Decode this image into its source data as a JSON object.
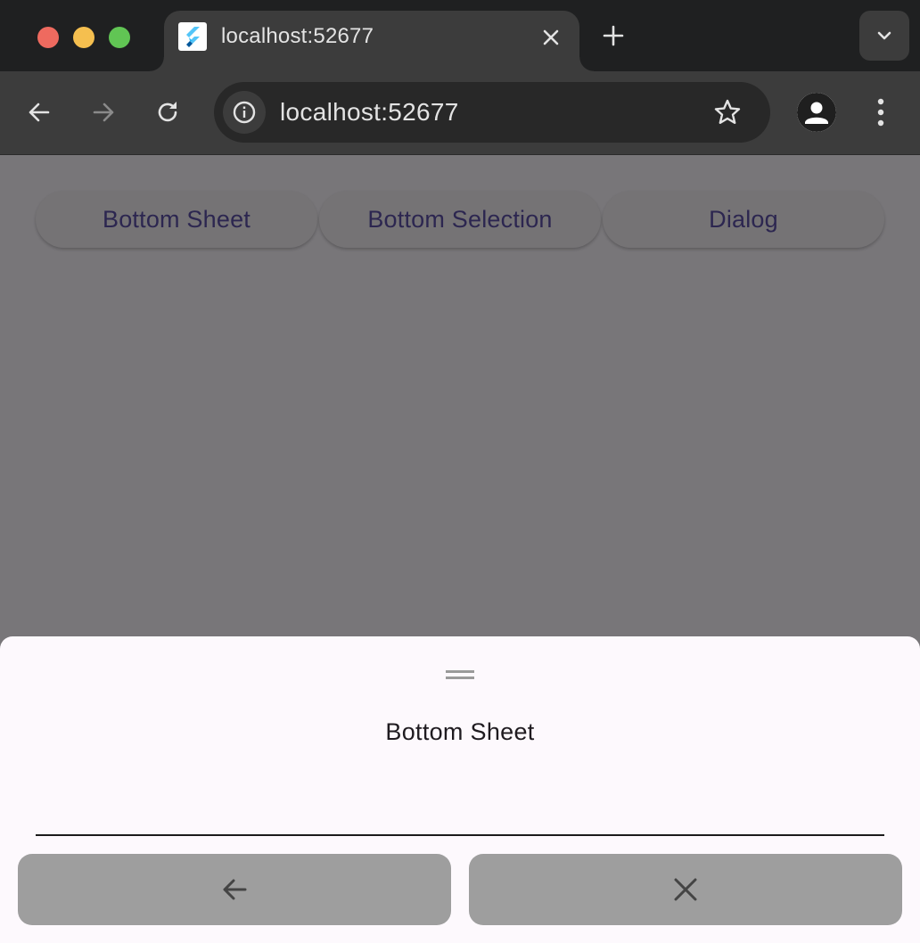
{
  "browser": {
    "tab": {
      "title": "localhost:52677",
      "favicon": "flutter-logo-icon"
    },
    "url": "localhost:52677",
    "icons": {
      "back": "arrow-left-icon",
      "forward": "arrow-right-icon",
      "reload": "reload-icon",
      "site_info": "info-icon",
      "bookmark": "star-icon",
      "profile": "person-icon",
      "menu": "more-vert-icon",
      "tab_close": "close-icon",
      "new_tab": "plus-icon",
      "tab_search": "chevron-down-icon"
    }
  },
  "page": {
    "buttons": [
      {
        "label": "Bottom Sheet"
      },
      {
        "label": "Bottom Selection"
      },
      {
        "label": "Dialog"
      }
    ]
  },
  "bottom_sheet": {
    "title": "Bottom Sheet",
    "actions": [
      {
        "icon": "arrow-back-icon"
      },
      {
        "icon": "close-icon"
      }
    ]
  },
  "colors": {
    "barrier_page": "#787679",
    "sheet_bg": "#fdf9fd",
    "action_bg": "#9e9e9e",
    "button_text": "#2c2650"
  }
}
